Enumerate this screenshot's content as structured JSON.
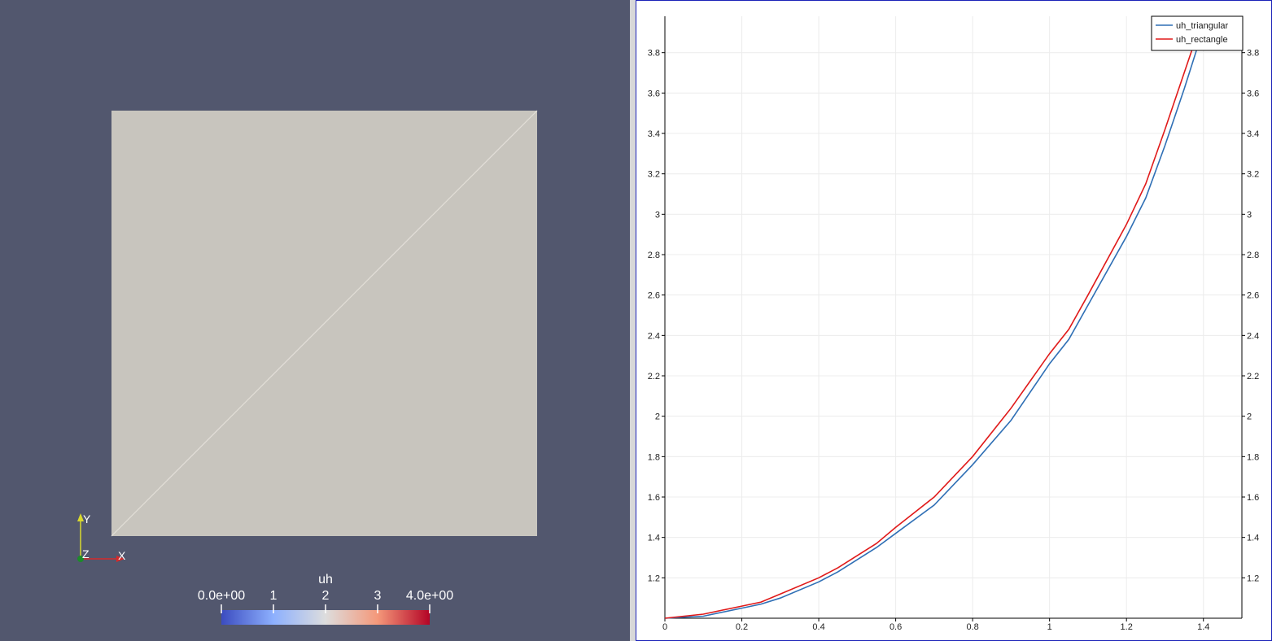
{
  "render_view": {
    "colors": {
      "background": "#52576e",
      "surface": "#c8c5be",
      "edge": "#e2dfd8",
      "axis_x": "#d42a2a",
      "axis_y": "#d9d92e",
      "axis_z": "#1d8a2a"
    },
    "axes_widget": {
      "x_label": "X",
      "y_label": "Y",
      "z_label": "Z"
    },
    "colorbar": {
      "title": "uh",
      "min_label": "0.0e+00",
      "max_label": "4.0e+00",
      "tick_labels": [
        "1",
        "2",
        "3"
      ],
      "range": [
        0,
        4
      ],
      "colormap": [
        "#3b4cc0",
        "#8db0fe",
        "#dddddd",
        "#f4987a",
        "#b40426"
      ]
    }
  },
  "chart_data": {
    "type": "line",
    "xlim": [
      0,
      1.5
    ],
    "ylim": [
      1.0,
      3.98
    ],
    "x_ticks": [
      "0",
      "0.2",
      "0.4",
      "0.6",
      "0.8",
      "1",
      "1.2",
      "1.4"
    ],
    "y_ticks": [
      "1.2",
      "1.4",
      "1.6",
      "1.8",
      "2",
      "2.2",
      "2.4",
      "2.6",
      "2.8",
      "3",
      "3.2",
      "3.4",
      "3.6",
      "3.8"
    ],
    "grid": true,
    "legend_position": "top-right",
    "series": [
      {
        "name": "uh_triangular",
        "color": "#2f6fb5",
        "x": [
          0,
          0.1,
          0.2,
          0.25,
          0.3,
          0.4,
          0.45,
          0.55,
          0.6,
          0.7,
          0.8,
          0.9,
          1.0,
          1.05,
          1.1,
          1.2,
          1.25,
          1.3,
          1.35,
          1.41
        ],
        "y": [
          1.0,
          1.01,
          1.05,
          1.07,
          1.1,
          1.18,
          1.23,
          1.35,
          1.42,
          1.56,
          1.76,
          1.98,
          2.26,
          2.38,
          2.55,
          2.89,
          3.08,
          3.34,
          3.62,
          3.98
        ]
      },
      {
        "name": "uh_rectangle",
        "color": "#e01a1a",
        "x": [
          0,
          0.1,
          0.2,
          0.25,
          0.3,
          0.4,
          0.45,
          0.55,
          0.6,
          0.7,
          0.8,
          0.9,
          1.0,
          1.05,
          1.1,
          1.2,
          1.25,
          1.3,
          1.35,
          1.4
        ],
        "y": [
          1.0,
          1.02,
          1.06,
          1.08,
          1.12,
          1.2,
          1.25,
          1.37,
          1.45,
          1.6,
          1.8,
          2.04,
          2.31,
          2.43,
          2.6,
          2.95,
          3.15,
          3.42,
          3.7,
          3.98
        ]
      }
    ]
  }
}
